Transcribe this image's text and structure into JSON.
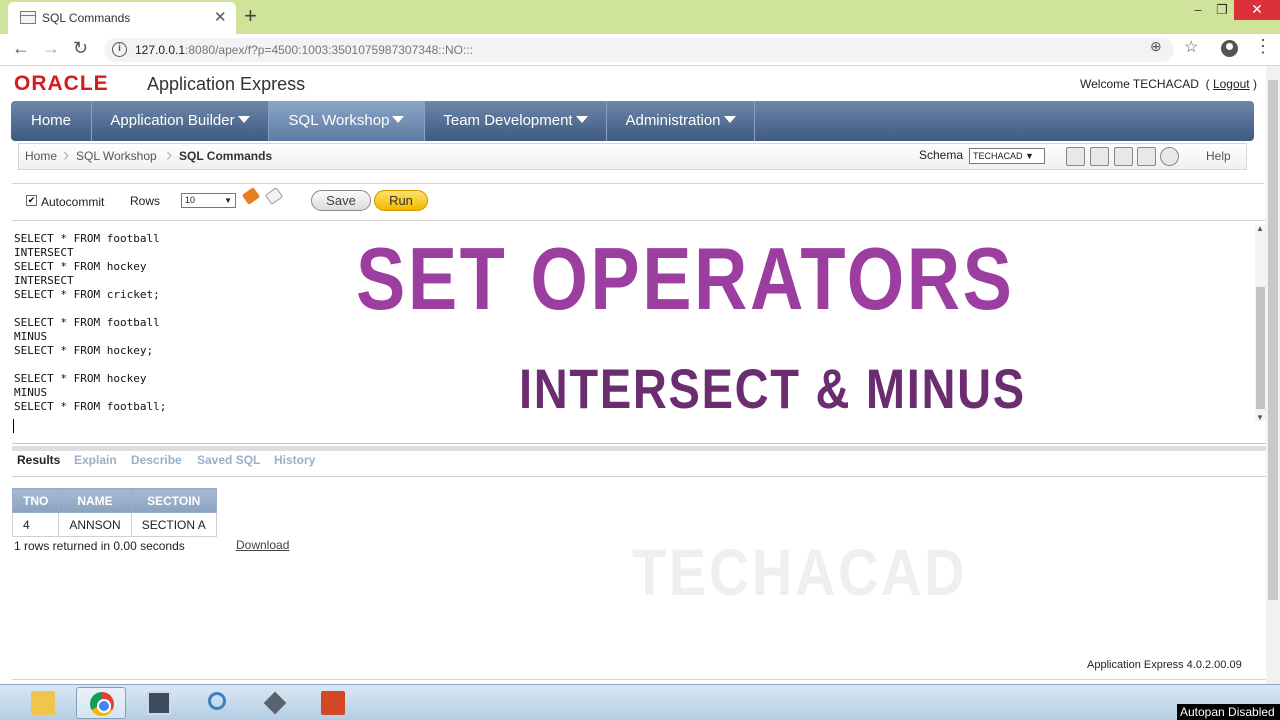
{
  "browser": {
    "tab_title": "SQL Commands",
    "tab_close": "✕",
    "new_tab": "+",
    "url_host": "127.0.0.1",
    "url_rest": ":8080/apex/f?p=4500:1003:3501075987307348::NO:::",
    "controls": {
      "minimize": "–",
      "maximize": "❐",
      "close": "✕"
    }
  },
  "header": {
    "logo": "ORACLE",
    "app_name": "Application Express",
    "welcome": "Welcome TECHACAD",
    "logout_open": "( ",
    "logout": "Logout",
    "logout_close": " )"
  },
  "nav": {
    "tabs": [
      {
        "label": "Home"
      },
      {
        "label": "Application Builder"
      },
      {
        "label": "SQL Workshop"
      },
      {
        "label": "Team Development"
      },
      {
        "label": "Administration"
      }
    ]
  },
  "breadcrumb": {
    "items": [
      "Home",
      "SQL Workshop",
      "SQL Commands"
    ],
    "schema_label": "Schema",
    "schema_value": "TECHACAD ▼",
    "help": "Help"
  },
  "sql_toolbar": {
    "autocommit_label": "Autocommit",
    "autocommit_checked": "✔",
    "rows_label": "Rows",
    "rows_value": "10",
    "save": "Save",
    "run": "Run"
  },
  "editor": {
    "lines": [
      "SELECT * FROM football",
      "INTERSECT",
      "SELECT * FROM hockey",
      "INTERSECT",
      "SELECT * FROM cricket;",
      "",
      "SELECT * FROM football",
      "MINUS",
      "SELECT * FROM hockey;",
      "",
      "SELECT * FROM hockey",
      "MINUS",
      "SELECT * FROM football;"
    ]
  },
  "overlay": {
    "title": "SET OPERATORS",
    "subtitle": "INTERSECT & MINUS",
    "title_color": "#9b3ea0",
    "subtitle_color": "#6b2d70"
  },
  "results": {
    "tabs": [
      "Results",
      "Explain",
      "Describe",
      "Saved SQL",
      "History"
    ],
    "columns": [
      "TNO",
      "NAME",
      "SECTOIN"
    ],
    "rows": [
      [
        "4",
        "ANNSON",
        "SECTION A"
      ]
    ],
    "summary": "1 rows returned in 0.00 seconds",
    "download": "Download"
  },
  "watermark": "TECHACAD",
  "footer": {
    "version": "Application Express 4.0.2.00.09"
  },
  "taskbar": {
    "apps": [
      "folder-icon",
      "chrome-icon",
      "window-icon",
      "search-icon",
      "tool-icon",
      "powerpoint-icon"
    ],
    "status": "Autopan Disabled"
  }
}
